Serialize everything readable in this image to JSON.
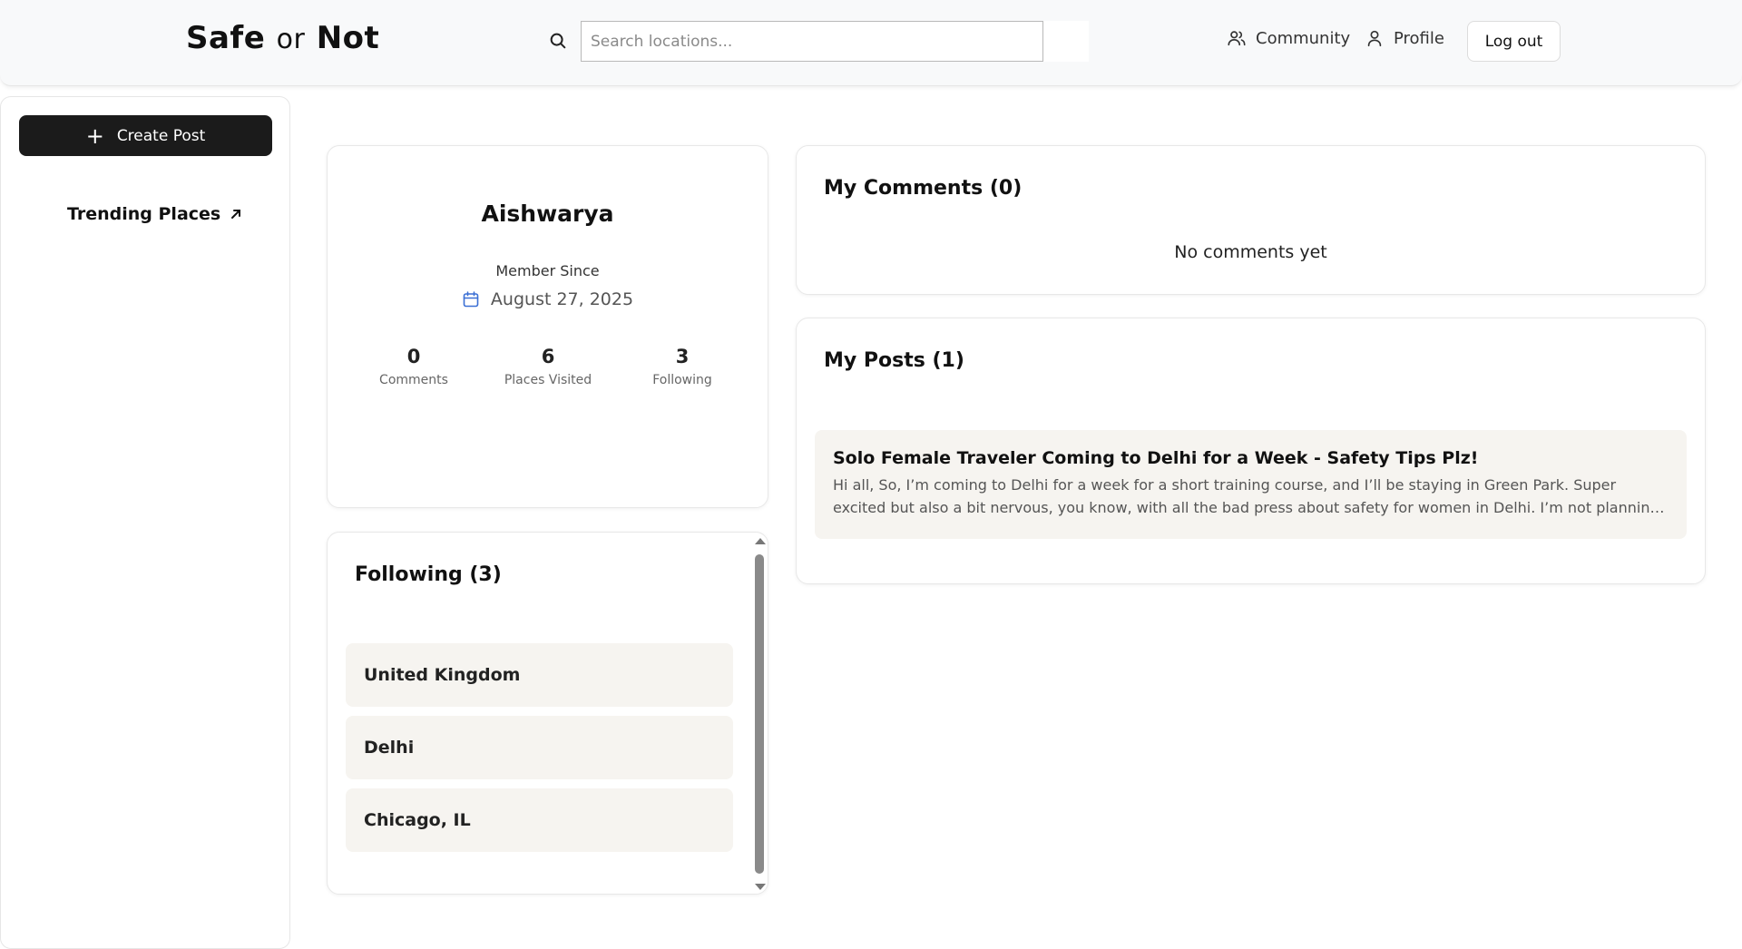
{
  "header": {
    "logo_main": "Safe",
    "logo_or": "or",
    "logo_end": "Not",
    "search_placeholder": "Search locations...",
    "nav_community": "Community",
    "nav_profile": "Profile",
    "logout_label": "Log out"
  },
  "sidebar": {
    "create_post_label": "Create Post",
    "trending_label": "Trending Places"
  },
  "profile": {
    "username": "Aishwarya",
    "member_since_label": "Member Since",
    "member_since_date": "August 27, 2025",
    "stats": [
      {
        "value": "0",
        "label": "Comments"
      },
      {
        "value": "6",
        "label": "Places Visited"
      },
      {
        "value": "3",
        "label": "Following"
      }
    ]
  },
  "following": {
    "title": "Following (3)",
    "items": [
      "United Kingdom",
      "Delhi",
      "Chicago, IL"
    ]
  },
  "comments": {
    "title": "My Comments (0)",
    "empty_text": "No comments yet"
  },
  "posts": {
    "title": "My Posts (1)",
    "items": [
      {
        "title": "Solo Female Traveler Coming to Delhi for a Week - Safety Tips Plz!",
        "excerpt": "Hi all, So, I’m coming to Delhi for a week for a short training course, and I’ll be staying in Green Park. Super excited but also a bit nervous, you know, with all the bad press about safety for women in Delhi. I’m not planning to stay out all..."
      }
    ]
  },
  "colors": {
    "primary_button": "#1b1b1b",
    "item_background": "#f6f4f0",
    "calendar_icon": "#3b6fd4"
  }
}
